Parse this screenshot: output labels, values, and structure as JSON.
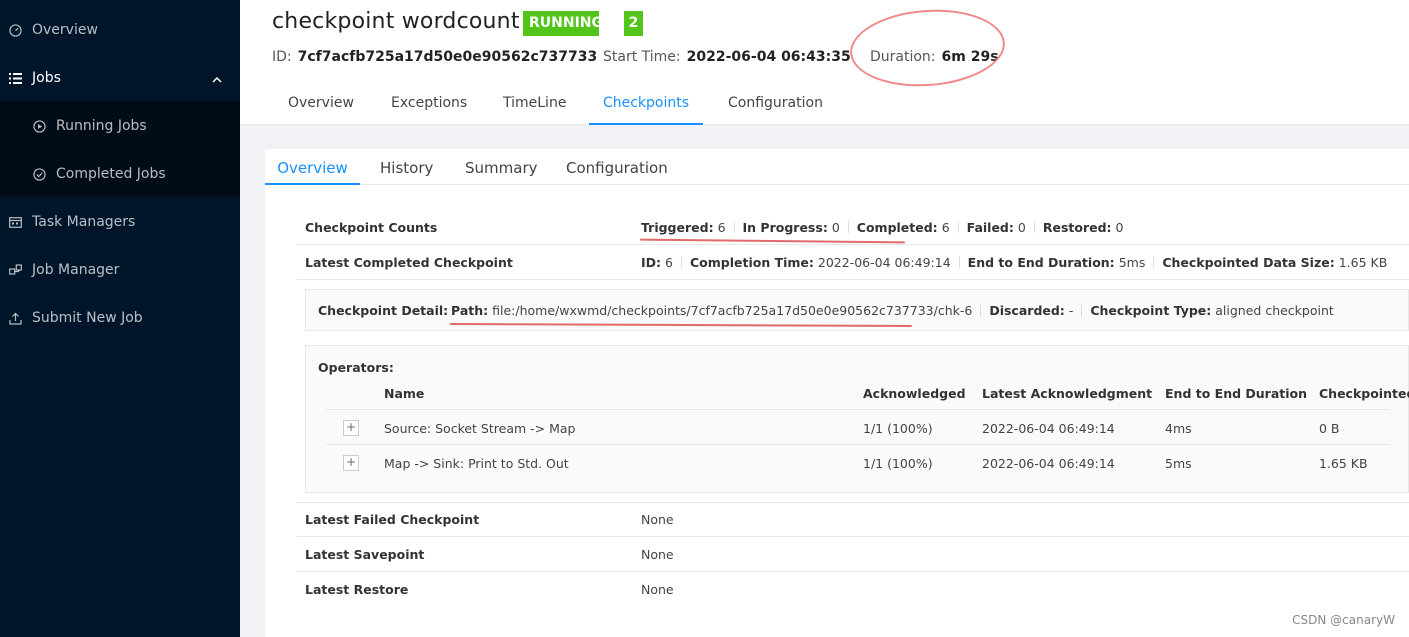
{
  "sidebar": {
    "overview": "Overview",
    "jobs": "Jobs",
    "running_jobs": "Running Jobs",
    "completed_jobs": "Completed Jobs",
    "task_managers": "Task Managers",
    "job_manager": "Job Manager",
    "submit_new_job": "Submit New Job"
  },
  "job": {
    "name": "checkpoint wordcount",
    "status": "RUNNING",
    "tasks_count": "2",
    "id_label": "ID:",
    "id": "7cf7acfb725a17d50e0e90562c737733",
    "start_label": "Start Time:",
    "start_time": "2022-06-04 06:43:35",
    "duration_label": "Duration:",
    "duration": "6m 29s"
  },
  "job_tabs": [
    "Overview",
    "Exceptions",
    "TimeLine",
    "Checkpoints",
    "Configuration"
  ],
  "cp_tabs": [
    "Overview",
    "History",
    "Summary",
    "Configuration"
  ],
  "counts": {
    "label": "Checkpoint Counts",
    "triggered_label": "Triggered:",
    "triggered": "6",
    "in_progress_label": "In Progress:",
    "in_progress": "0",
    "completed_label": "Completed:",
    "completed": "6",
    "failed_label": "Failed:",
    "failed": "0",
    "restored_label": "Restored:",
    "restored": "0"
  },
  "latest_completed": {
    "label": "Latest Completed Checkpoint",
    "id_label": "ID:",
    "id": "6",
    "time_label": "Completion Time:",
    "time": "2022-06-04 06:49:14",
    "e2e_label": "End to End Duration:",
    "e2e": "5ms",
    "size_label": "Checkpointed Data Size:",
    "size": "1.65 KB"
  },
  "detail": {
    "label": "Checkpoint Detail:",
    "path_label": "Path:",
    "path": "file:/home/wxwmd/checkpoints/7cf7acfb725a17d50e0e90562c737733/chk-6",
    "discarded_label": "Discarded:",
    "discarded": "-",
    "type_label": "Checkpoint Type:",
    "type": "aligned checkpoint"
  },
  "operators": {
    "label": "Operators:",
    "headers": [
      "Name",
      "Acknowledged",
      "Latest Acknowledgment",
      "End to End Duration",
      "Checkpointed D"
    ],
    "plus": "+",
    "rows": [
      {
        "name": "Source: Socket Stream -> Map",
        "ack": "1/1 (100%)",
        "latest": "2022-06-04 06:49:14",
        "e2e": "4ms",
        "size": "0 B"
      },
      {
        "name": "Map -> Sink: Print to Std. Out",
        "ack": "1/1 (100%)",
        "latest": "2022-06-04 06:49:14",
        "e2e": "5ms",
        "size": "1.65 KB"
      }
    ]
  },
  "latest_failed": {
    "label": "Latest Failed Checkpoint",
    "value": "None"
  },
  "latest_savepoint": {
    "label": "Latest Savepoint",
    "value": "None"
  },
  "latest_restore": {
    "label": "Latest Restore",
    "value": "None"
  },
  "watermark": "CSDN @canaryW",
  "colors": {
    "sidebar_bg": "#001529",
    "accent": "#1890ff",
    "running": "#52c41a",
    "annotation": "#e46a6a"
  }
}
